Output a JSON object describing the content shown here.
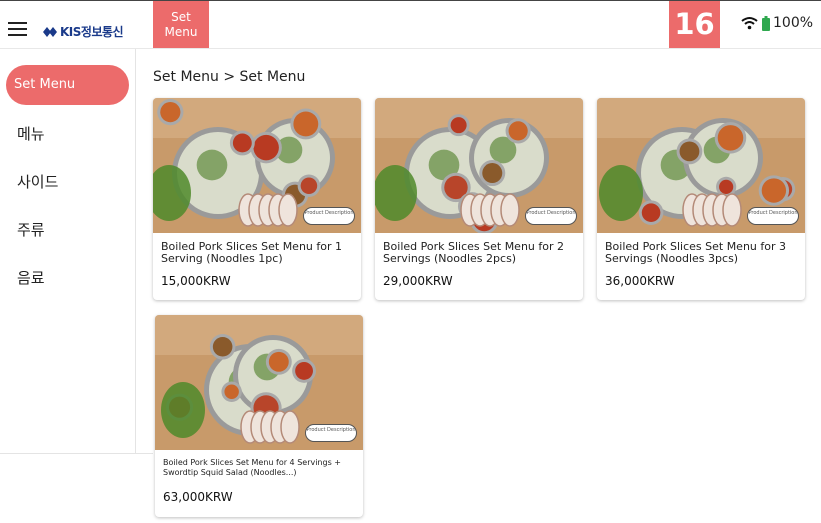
{
  "header": {
    "logo_text": "KIS정보통신",
    "set_tab_label": "Set\nMenu",
    "table_number": "16",
    "battery_text": "100%",
    "accent_color": "#ec6b6b"
  },
  "sidebar": {
    "items": [
      {
        "label": "Set Menu",
        "active": true
      },
      {
        "label": "메뉴"
      },
      {
        "label": "사이드"
      },
      {
        "label": "주류"
      },
      {
        "label": "음료"
      }
    ]
  },
  "breadcrumb": "Set Menu > Set Menu",
  "products": [
    {
      "name": "Boiled Pork Slices Set Menu for 1 Serving (Noodles 1pc)",
      "price": "15,000KRW",
      "desc_label": "Product Description",
      "icon": "noodle-set-photo"
    },
    {
      "name": "Boiled Pork Slices Set Menu for 2 Servings (Noodles 2pcs)",
      "price": "29,000KRW",
      "desc_label": "Product Description",
      "icon": "noodle-set-photo"
    },
    {
      "name": "Boiled Pork Slices Set Menu for 3 Servings (Noodles 3pcs)",
      "price": "36,000KRW",
      "desc_label": "Product Description",
      "icon": "noodle-set-photo"
    },
    {
      "name": "Boiled Pork Slices Set Menu for 4 Servings + Swordtip Squid Salad (Noodles...)",
      "price": "63,000KRW",
      "desc_label": "Product Description",
      "icon": "noodle-set-photo"
    }
  ]
}
